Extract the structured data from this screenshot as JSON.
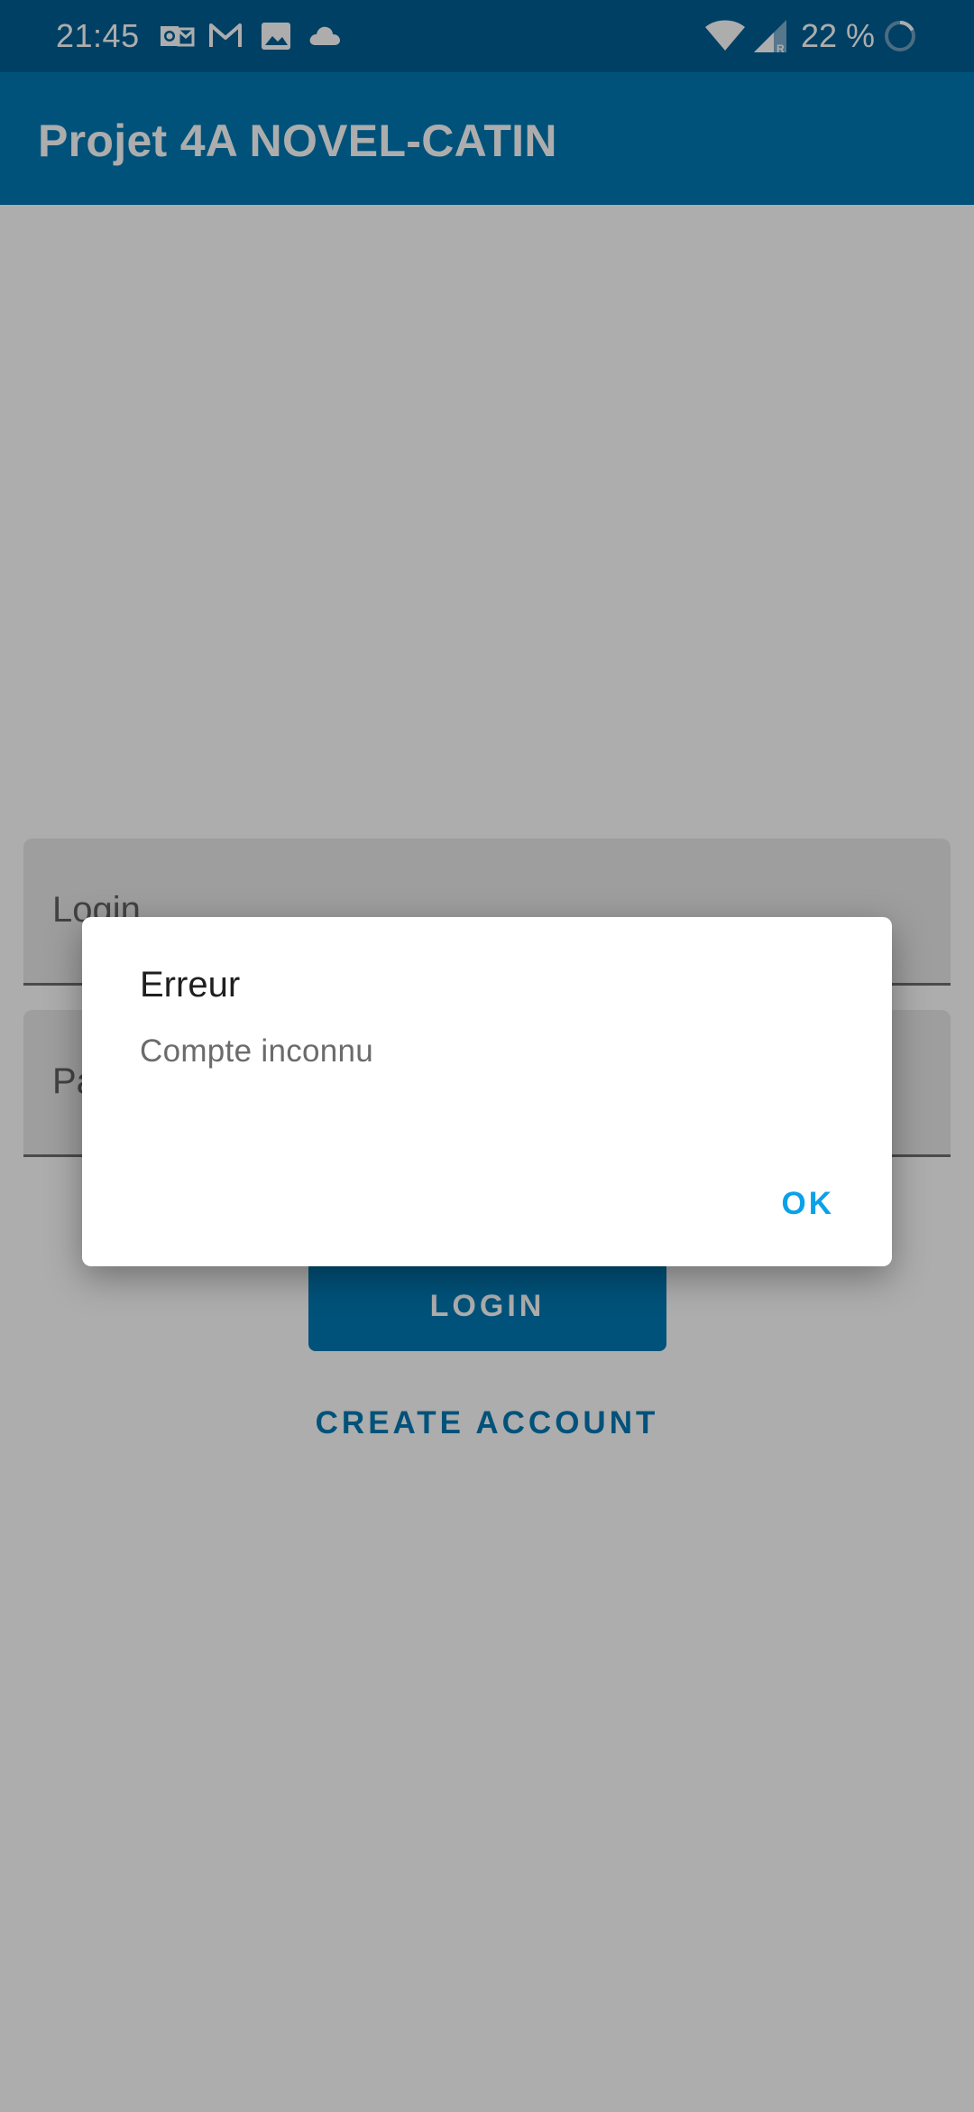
{
  "status_bar": {
    "time": "21:45",
    "battery_percent": "22 %",
    "icons": [
      "outlook-icon",
      "gmail-icon",
      "gallery-icon",
      "cloud-icon",
      "wifi-icon",
      "signal-icon",
      "battery-icon"
    ]
  },
  "app_bar": {
    "title": "Projet 4A NOVEL-CATIN"
  },
  "form": {
    "login_placeholder": "Login",
    "password_placeholder": "Password",
    "login_button": "LOGIN",
    "create_account": "CREATE ACCOUNT"
  },
  "dialog": {
    "title": "Erreur",
    "message": "Compte inconnu",
    "ok_button": "OK"
  },
  "colors": {
    "status_bar": "#015f96",
    "primary": "#0179b4",
    "dialog_accent": "#0aa1e8",
    "scrim": "rgba(0,0,0,0.32)"
  }
}
